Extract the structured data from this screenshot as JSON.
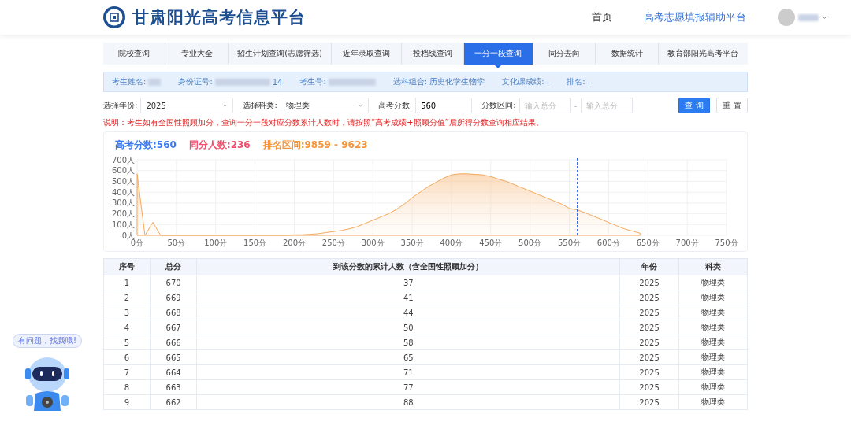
{
  "header": {
    "title": "甘肃阳光高考信息平台",
    "links": [
      {
        "label": "首页",
        "selected": false
      },
      {
        "label": "高考志愿填报辅助平台",
        "selected": true
      }
    ]
  },
  "nav": [
    {
      "label": "院校查询",
      "selected": false
    },
    {
      "label": "专业大全",
      "selected": false
    },
    {
      "label": "招生计划查询(志愿筛选)",
      "selected": false
    },
    {
      "label": "近年录取查询",
      "selected": false
    },
    {
      "label": "投档线查询",
      "selected": false
    },
    {
      "label": "一分一段查询",
      "selected": true
    },
    {
      "label": "同分去向",
      "selected": false
    },
    {
      "label": "数据统计",
      "selected": false
    },
    {
      "label": "教育部阳光高考平台",
      "selected": false
    }
  ],
  "student_info": [
    {
      "label": "考生姓名:",
      "masked": true
    },
    {
      "label": "身份证号:",
      "value": "14",
      "masked": true
    },
    {
      "label": "考生号:",
      "masked": true
    },
    {
      "label": "选科组合:",
      "value": "历史化学生物学",
      "masked": false
    },
    {
      "label": "文化课成绩:",
      "value": "-",
      "masked": false
    },
    {
      "label": "排名:",
      "value": "-",
      "masked": false
    }
  ],
  "filters": {
    "year": {
      "label": "选择年份:",
      "value": "2025"
    },
    "subject": {
      "label": "选择科类:",
      "value": "物理类"
    },
    "score": {
      "label": "高考分数:",
      "value": "560"
    },
    "range": {
      "label": "分数区间:",
      "from_placeholder": "输入总分",
      "separator": "-",
      "to_placeholder": "输入总分"
    },
    "buttons": [
      {
        "label": "查 询",
        "kind": "primary"
      },
      {
        "label": "重 置",
        "kind": "default"
      }
    ]
  },
  "note": "说明：考生如有全国性照顾加分，查询一分一段对应分数累计人数时，请按照“高考成绩+照顾分值”后所得分数查询相应结果。",
  "summary": [
    {
      "text": "高考分数:560",
      "color": "#3b7bf0"
    },
    {
      "text": "同分人数:236",
      "color": "#f0506e"
    },
    {
      "text": "排名区间:9859 - 9623",
      "color": "#f5953a"
    }
  ],
  "chart_data": {
    "type": "area",
    "x": [
      0,
      10,
      20,
      30,
      50,
      100,
      150,
      190,
      200,
      210,
      220,
      230,
      240,
      250,
      260,
      270,
      280,
      290,
      300,
      310,
      320,
      330,
      340,
      350,
      360,
      370,
      380,
      390,
      400,
      410,
      420,
      430,
      440,
      450,
      460,
      470,
      480,
      490,
      500,
      510,
      520,
      530,
      540,
      550,
      560,
      570,
      580,
      590,
      600,
      610,
      620,
      630,
      640
    ],
    "series": [
      {
        "color": "#f5a85a",
        "values": [
          570,
          0,
          120,
          0,
          0,
          0,
          0,
          0,
          5,
          5,
          10,
          15,
          25,
          35,
          45,
          60,
          80,
          110,
          140,
          170,
          200,
          240,
          290,
          350,
          400,
          450,
          490,
          530,
          560,
          570,
          570,
          565,
          560,
          545,
          520,
          500,
          470,
          440,
          410,
          380,
          350,
          320,
          290,
          250,
          236,
          210,
          180,
          150,
          120,
          90,
          60,
          40,
          20
        ]
      }
    ],
    "xlim": [
      0,
      750
    ],
    "ylim": [
      0,
      700
    ],
    "xticks": [
      {
        "value": 0,
        "label": "0分"
      },
      {
        "value": 50,
        "label": "50分"
      },
      {
        "value": 100,
        "label": "100分"
      },
      {
        "value": 150,
        "label": "150分"
      },
      {
        "value": 200,
        "label": "200分"
      },
      {
        "value": 250,
        "label": "250分"
      },
      {
        "value": 300,
        "label": "300分"
      },
      {
        "value": 350,
        "label": "350分"
      },
      {
        "value": 400,
        "label": "400分"
      },
      {
        "value": 450,
        "label": "450分"
      },
      {
        "value": 500,
        "label": "500分"
      },
      {
        "value": 550,
        "label": "550分"
      },
      {
        "value": 600,
        "label": "600分"
      },
      {
        "value": 650,
        "label": "650分"
      },
      {
        "value": 700,
        "label": "700分"
      },
      {
        "value": 750,
        "label": "750分"
      }
    ],
    "yticks": [
      {
        "value": 0,
        "label": "0人"
      },
      {
        "value": 100,
        "label": "100人"
      },
      {
        "value": 200,
        "label": "200人"
      },
      {
        "value": 300,
        "label": "300人"
      },
      {
        "value": 400,
        "label": "400人"
      },
      {
        "value": 500,
        "label": "500人"
      },
      {
        "value": 600,
        "label": "600人"
      },
      {
        "value": 700,
        "label": "700人"
      }
    ],
    "grid": true,
    "ref_lines": [
      {
        "axis": "x",
        "value": 560,
        "color": "#3b6fe0"
      }
    ]
  },
  "table": {
    "columns": [
      "序号",
      "总分",
      "到该分数的累计人数（含全国性照顾加分）",
      "年份",
      "科类"
    ],
    "rows": [
      [
        "1",
        "670",
        "37",
        "2025",
        "物理类"
      ],
      [
        "2",
        "669",
        "41",
        "2025",
        "物理类"
      ],
      [
        "3",
        "668",
        "44",
        "2025",
        "物理类"
      ],
      [
        "4",
        "667",
        "50",
        "2025",
        "物理类"
      ],
      [
        "5",
        "666",
        "58",
        "2025",
        "物理类"
      ],
      [
        "6",
        "665",
        "65",
        "2025",
        "物理类"
      ],
      [
        "7",
        "664",
        "71",
        "2025",
        "物理类"
      ],
      [
        "8",
        "663",
        "77",
        "2025",
        "物理类"
      ],
      [
        "9",
        "662",
        "88",
        "2025",
        "物理类"
      ]
    ]
  },
  "assistant": {
    "bubble": "有问题，找我哦!"
  }
}
